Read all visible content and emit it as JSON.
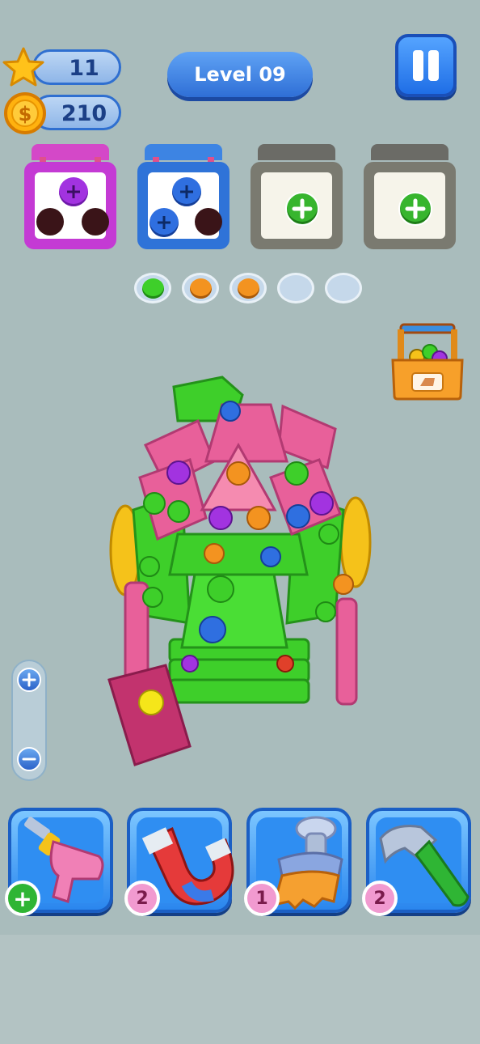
{
  "hud": {
    "stars": "11",
    "coins": "210",
    "level": "Level 09"
  },
  "boxes": [
    {
      "color": "#c43ad4",
      "handle": "#d448c8",
      "screws": [
        "purple",
        "hole",
        "hole"
      ]
    },
    {
      "color": "#2f73d8",
      "handle": "#3d84e3",
      "screws": [
        "blue",
        "blue",
        "hole"
      ]
    },
    {
      "color": "#7a7a70",
      "handle": "#6b6b66",
      "screws": [
        "add"
      ]
    },
    {
      "color": "#7a7a70",
      "handle": "#6b6b66",
      "screws": [
        "add"
      ]
    }
  ],
  "tray": [
    "green",
    "orange",
    "orange",
    "empty",
    "empty"
  ],
  "tools": [
    {
      "name": "drill",
      "badge": "+"
    },
    {
      "name": "magnet",
      "badge": "2"
    },
    {
      "name": "brush",
      "badge": "1"
    },
    {
      "name": "hammer",
      "badge": "2"
    }
  ],
  "colors": {
    "purple": "#a233e0",
    "blue": "#2f6fe0",
    "green": "#3ecf2a",
    "orange": "#f39320"
  }
}
